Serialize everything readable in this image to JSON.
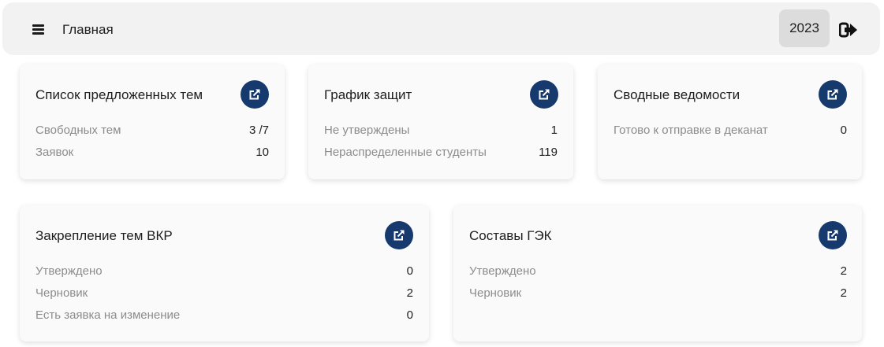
{
  "header": {
    "menu_icon": "hamburger-menu-icon",
    "title": "Главная",
    "year": "2023",
    "logout_icon": "sign-out-icon"
  },
  "accent_color": "#173a6e",
  "cards": [
    {
      "title": "Список предложенных тем",
      "open_icon": "external-link-icon",
      "rows": [
        {
          "label": "Свободных тем",
          "value": "3 /7"
        },
        {
          "label": "Заявок",
          "value": "10"
        }
      ]
    },
    {
      "title": "График защит",
      "open_icon": "external-link-icon",
      "rows": [
        {
          "label": "Не утверждены",
          "value": "1"
        },
        {
          "label": "Нераспределенные студенты",
          "value": "119"
        }
      ]
    },
    {
      "title": "Сводные ведомости",
      "open_icon": "external-link-icon",
      "rows": [
        {
          "label": "Готово к отправке в деканат",
          "value": "0"
        }
      ]
    },
    {
      "title": "Закрепление тем ВКР",
      "open_icon": "external-link-icon",
      "rows": [
        {
          "label": "Утверждено",
          "value": "0"
        },
        {
          "label": "Черновик",
          "value": "2"
        },
        {
          "label": "Есть заявка на изменение",
          "value": "0"
        }
      ]
    },
    {
      "title": "Составы ГЭК",
      "open_icon": "external-link-icon",
      "rows": [
        {
          "label": "Утверждено",
          "value": "2"
        },
        {
          "label": "Черновик",
          "value": "2"
        }
      ]
    }
  ]
}
